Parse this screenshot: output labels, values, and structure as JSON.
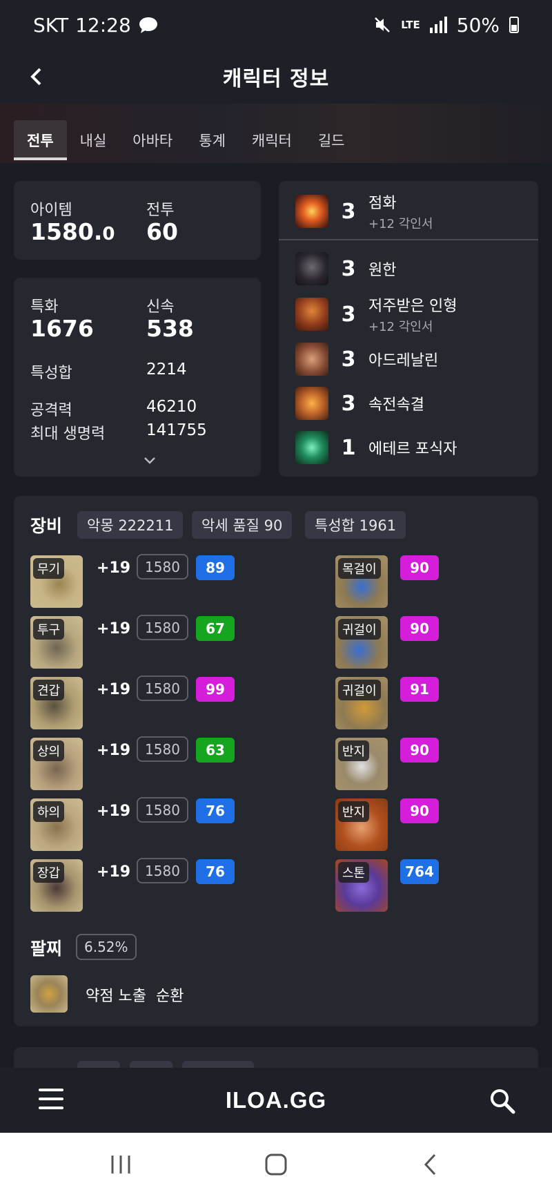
{
  "status_bar": {
    "carrier": "SKT",
    "time": "12:28",
    "network": "LTE",
    "battery": "50%"
  },
  "header": {
    "title": "캐릭터 정보"
  },
  "tabs": [
    {
      "label": "전투",
      "active": true
    },
    {
      "label": "내실",
      "active": false
    },
    {
      "label": "아바타",
      "active": false
    },
    {
      "label": "통계",
      "active": false
    },
    {
      "label": "캐릭터",
      "active": false
    },
    {
      "label": "길드",
      "active": false
    }
  ],
  "level_card": {
    "item_label": "아이템",
    "item_value_main": "1580.",
    "item_value_decimal": "0",
    "combat_label": "전투",
    "combat_value": "60"
  },
  "stats_card": {
    "crit_label": "특화",
    "crit_value": "1676",
    "swift_label": "신속",
    "swift_value": "538",
    "total_label": "특성합",
    "total_value": "2214",
    "attack_label": "공격력",
    "attack_value": "46210",
    "hp_label": "최대 생명력",
    "hp_value": "141755"
  },
  "engravings": [
    {
      "level": "3",
      "name": "점화",
      "sub": "+12 각인서",
      "color": "#c8442a"
    },
    {
      "level": "3",
      "name": "원한",
      "sub": "",
      "color": "#3a2e30"
    },
    {
      "level": "3",
      "name": "저주받은 인형",
      "sub": "+12 각인서",
      "color": "#a4471f"
    },
    {
      "level": "3",
      "name": "아드레날린",
      "sub": "",
      "color": "#7d4d3c"
    },
    {
      "level": "3",
      "name": "속전속결",
      "sub": "",
      "color": "#c0662a"
    },
    {
      "level": "1",
      "name": "에테르 포식자",
      "sub": "",
      "color": "#2a6b4a"
    }
  ],
  "equipment": {
    "title": "장비",
    "chips": [
      "악몽 222211",
      "악세 품질 90",
      "특성합 1961"
    ],
    "armor": [
      {
        "slot": "무기",
        "enhance": "+19",
        "ilvl": "1580",
        "quality": "89",
        "quality_color": "#1f6fe6"
      },
      {
        "slot": "투구",
        "enhance": "+19",
        "ilvl": "1580",
        "quality": "67",
        "quality_color": "#15a51f"
      },
      {
        "slot": "견갑",
        "enhance": "+19",
        "ilvl": "1580",
        "quality": "99",
        "quality_color": "#d41ed9"
      },
      {
        "slot": "상의",
        "enhance": "+19",
        "ilvl": "1580",
        "quality": "63",
        "quality_color": "#15a51f"
      },
      {
        "slot": "하의",
        "enhance": "+19",
        "ilvl": "1580",
        "quality": "76",
        "quality_color": "#1f6fe6"
      },
      {
        "slot": "장갑",
        "enhance": "+19",
        "ilvl": "1580",
        "quality": "76",
        "quality_color": "#1f6fe6"
      }
    ],
    "accessories": [
      {
        "slot": "목걸이",
        "quality": "90",
        "quality_color": "#d41ed9",
        "bg": "#8e7a52"
      },
      {
        "slot": "귀걸이",
        "quality": "90",
        "quality_color": "#d41ed9",
        "bg": "#8e7a52"
      },
      {
        "slot": "귀걸이",
        "quality": "91",
        "quality_color": "#d41ed9",
        "bg": "#8e7a52"
      },
      {
        "slot": "반지",
        "quality": "90",
        "quality_color": "#d41ed9",
        "bg": "#8e7a52"
      },
      {
        "slot": "반지",
        "quality": "90",
        "quality_color": "#d41ed9",
        "bg": "#a8471c"
      },
      {
        "slot": "스톤",
        "quality": "764",
        "quality_color": "#1f6fe6",
        "bg": "#a8471c"
      }
    ]
  },
  "bracelet": {
    "title": "팔찌",
    "percent": "6.52%",
    "effect1": "약점 노출",
    "effect2": "순환"
  },
  "app_bar": {
    "logo": "ILOA.GG"
  }
}
